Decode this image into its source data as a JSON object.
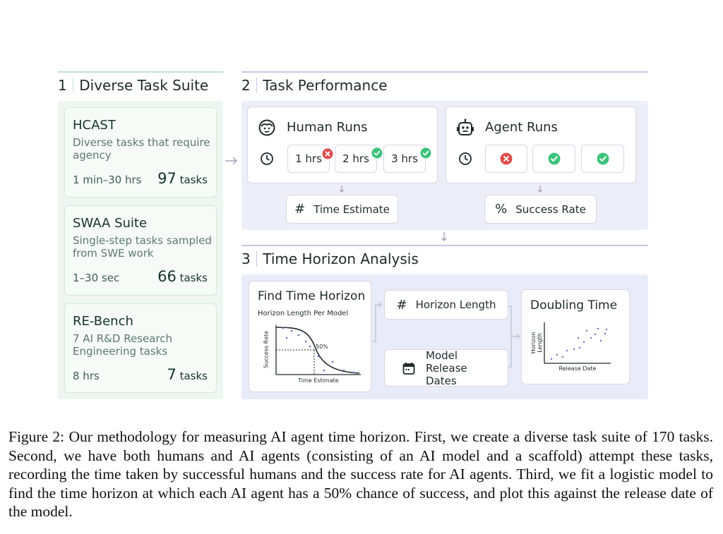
{
  "section1": {
    "number": "1",
    "title": "Diverse Task Suite",
    "cards": [
      {
        "name": "HCAST",
        "desc": "Diverse tasks that require agency",
        "time": "1 min–30 hrs",
        "count": "97",
        "count_unit": "tasks"
      },
      {
        "name": "SWAA Suite",
        "desc": "Single-step tasks sampled from SWE work",
        "time": "1–30 sec",
        "count": "66",
        "count_unit": "tasks"
      },
      {
        "name": "RE-Bench",
        "desc": "7 AI R&D Research Engineering tasks",
        "time": "8 hrs",
        "count": "7",
        "count_unit": "tasks"
      }
    ]
  },
  "section2": {
    "number": "2",
    "title": "Task Performance",
    "human": {
      "title": "Human Runs",
      "runs": [
        {
          "label": "1 hrs",
          "status": "fail"
        },
        {
          "label": "2 hrs",
          "status": "success"
        },
        {
          "label": "3 hrs",
          "status": "success"
        }
      ]
    },
    "agent": {
      "title": "Agent Runs",
      "runs": [
        {
          "status": "fail"
        },
        {
          "status": "success"
        },
        {
          "status": "success"
        }
      ]
    },
    "time_estimate": {
      "symbol": "#",
      "label": "Time Estimate"
    },
    "success_rate": {
      "symbol": "%",
      "label": "Success Rate"
    }
  },
  "section3": {
    "number": "3",
    "title": "Time Horizon Analysis",
    "find": {
      "title": "Find Time Horizon",
      "chart_title": "Horizon Length Per Model",
      "ylabel": "Success Rate",
      "xlabel": "Time Estimate",
      "marker_label": "50%"
    },
    "horizon_length": {
      "symbol": "#",
      "label": "Horizon Length"
    },
    "release_dates": {
      "label": "Model Release Dates"
    },
    "doubling": {
      "title": "Doubling Time",
      "ylabel": "Horizon Length",
      "xlabel": "Release Date"
    }
  },
  "caption": "Figure 2: Our methodology for measuring AI agent time horizon. First, we create a diverse task suite of 170 tasks. Second, we have both humans and AI agents (consisting of an AI model and a scaffold) attempt these tasks, recording the time taken by successful humans and the success rate for AI agents. Third, we fit a logistic model to find the time horizon at which each AI agent has a 50% chance of success, and plot this against the release date of the model.",
  "colors": {
    "green_accent": "#c4e0d0",
    "purple_accent": "#c8c6e4",
    "success": "#3cc37a",
    "fail": "#e24a4a"
  }
}
